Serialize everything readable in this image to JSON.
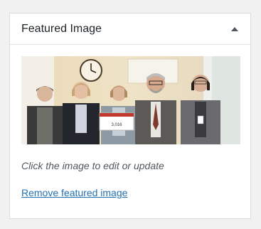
{
  "panel": {
    "title": "Featured Image",
    "toggle_icon": "triangle-up-icon",
    "caption": "Click the image to edit or update",
    "remove_label": "Remove featured image",
    "sign_text": "3,016"
  },
  "colors": {
    "background": "#f1f1f1",
    "panel_border": "#dcdcde",
    "link": "#2271b1",
    "caption": "#50575e",
    "title": "#1d2327"
  }
}
